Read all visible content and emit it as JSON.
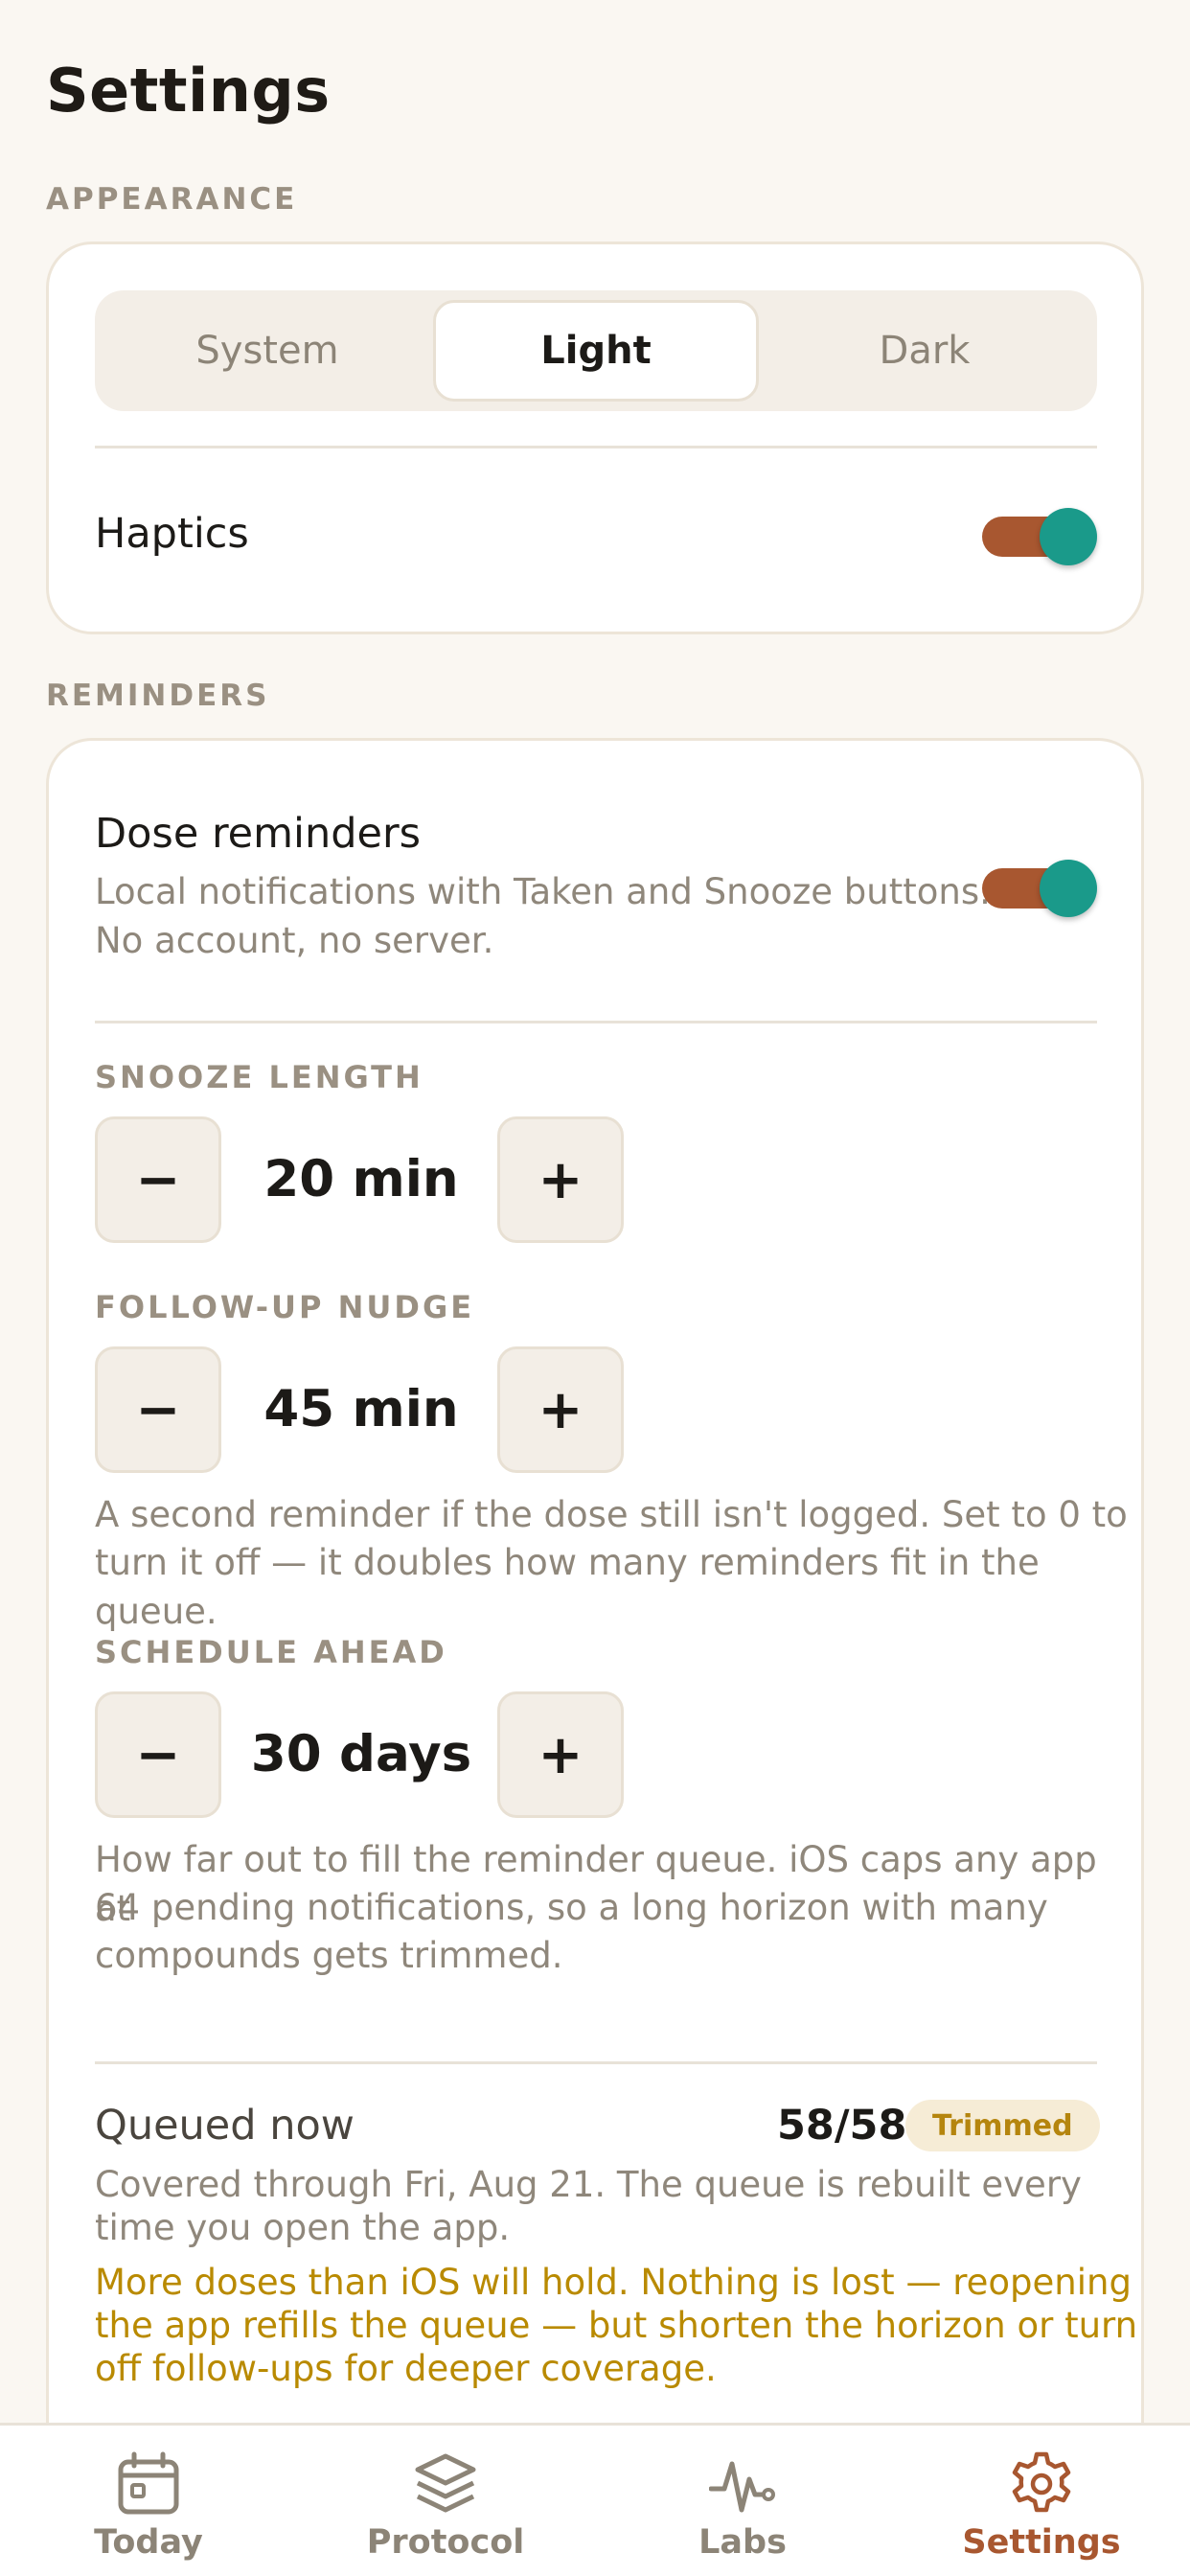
{
  "header": {
    "title": "Settings"
  },
  "appearance": {
    "section_label": "APPEARANCE",
    "segments": [
      "System",
      "Light",
      "Dark"
    ],
    "selected": "Light",
    "haptics": {
      "label": "Haptics",
      "enabled": true
    }
  },
  "reminders": {
    "section_label": "REMINDERS",
    "dose_reminders": {
      "label": "Dose reminders",
      "desc_line1": "Local notifications with Taken and Snooze buttons.",
      "desc_line2": "No account, no server.",
      "enabled": true
    },
    "snooze": {
      "label": "SNOOZE LENGTH",
      "value": "20 min",
      "minus": "−",
      "plus": "+"
    },
    "followup": {
      "label": "FOLLOW-UP NUDGE",
      "value": "45 min",
      "minus": "−",
      "plus": "+",
      "note_line1": "A second reminder if the dose still isn't logged. Set to 0 to",
      "note_line2": "turn it off — it doubles how many reminders fit in the queue."
    },
    "schedule": {
      "label": "SCHEDULE AHEAD",
      "value": "30 days",
      "minus": "−",
      "plus": "+",
      "note_line1": "How far out to fill the reminder queue. iOS caps any app at",
      "note_line2": "64 pending notifications, so a long horizon with many",
      "note_line3": "compounds gets trimmed."
    },
    "queue": {
      "label": "Queued now",
      "count": "58/58",
      "badge": "Trimmed",
      "info_line1": "Covered through Fri, Aug 21. The queue is rebuilt every",
      "info_line2": "time you open the app.",
      "warn_line1": "More doses than iOS will hold. Nothing is lost — reopening",
      "warn_line2": "the app refills the queue — but shorten the horizon or turn",
      "warn_line3": "off follow-ups for deeper coverage."
    }
  },
  "tabbar": {
    "tabs": [
      {
        "label": "Today",
        "icon": "calendar-icon"
      },
      {
        "label": "Protocol",
        "icon": "layers-icon"
      },
      {
        "label": "Labs",
        "icon": "pulse-icon"
      },
      {
        "label": "Settings",
        "icon": "gear-icon"
      }
    ],
    "active": "Settings"
  },
  "colors": {
    "accent": "#a85730",
    "toggle_knob": "#1a9a8a",
    "warning": "#b98a00",
    "background": "#faf7f2"
  }
}
